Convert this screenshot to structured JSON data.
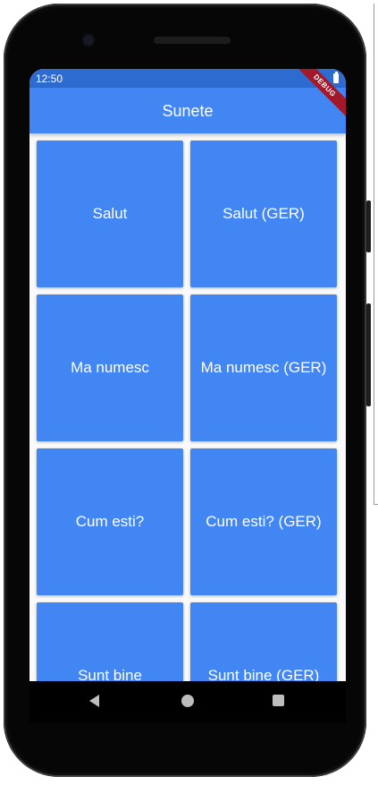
{
  "status_bar": {
    "time": "12:50",
    "battery_icon": "battery-icon"
  },
  "debug_banner": "DEBUG",
  "app_bar": {
    "title": "Sunete"
  },
  "tiles": [
    "Salut",
    "Salut (GER)",
    "Ma numesc",
    "Ma numesc (GER)",
    "Cum esti?",
    "Cum esti? (GER)",
    "Sunt bine",
    "Sunt bine (GER)"
  ],
  "nav_bar": {
    "icons": [
      "back-icon",
      "home-icon",
      "recents-icon"
    ]
  },
  "colors": {
    "primary": "#4286f4",
    "status_bar": "#2e6bd1",
    "debug_banner": "#a3182a",
    "background": "#fafafa"
  }
}
